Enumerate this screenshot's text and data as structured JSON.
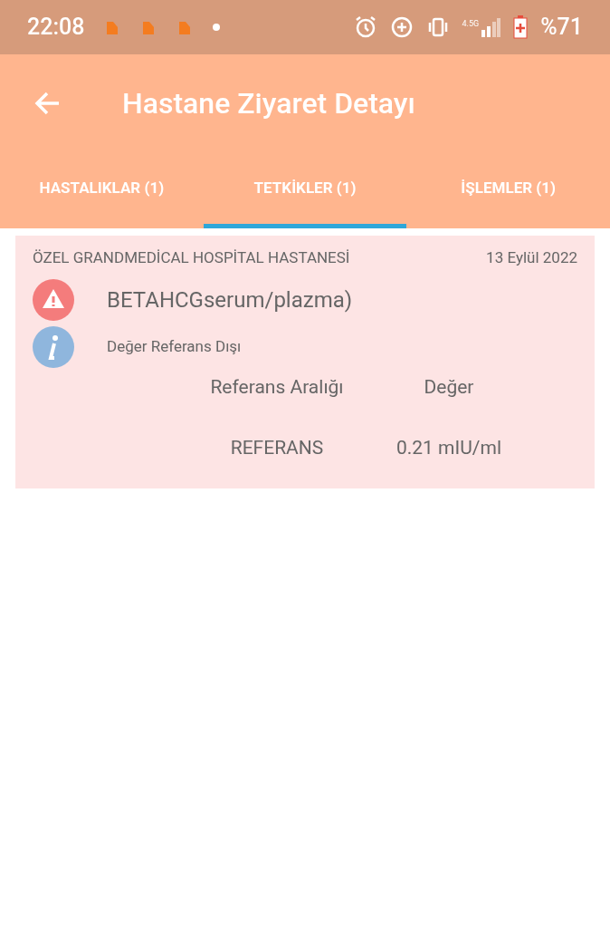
{
  "status_bar": {
    "time": "22:08",
    "network": "4.5G",
    "battery": "%71"
  },
  "app_bar": {
    "title": "Hastane Ziyaret Detayı"
  },
  "tabs": [
    {
      "label": "HASTALIKLAR (1)",
      "selected": false
    },
    {
      "label": "TETKİKLER (1)",
      "selected": true
    },
    {
      "label": "İŞLEMLER (1)",
      "selected": false
    }
  ],
  "results": [
    {
      "hospital": "ÖZEL GRANDMEDİCAL HOSPİTAL HASTANESİ",
      "date": "13 Eylül 2022",
      "test": "BETAHCGserum/plazma)",
      "note": "Değer Referans Dışı",
      "columns": [
        "Referans Aralığı",
        "Değer"
      ],
      "row": [
        "REFERANS",
        "0.21 mIU/ml"
      ]
    }
  ]
}
